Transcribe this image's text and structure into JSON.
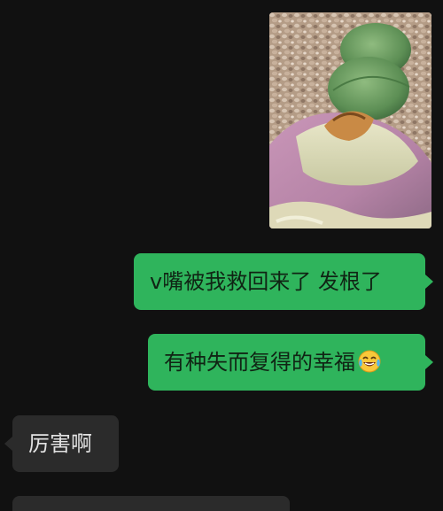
{
  "conversation": {
    "messages": [
      {
        "type": "image",
        "direction": "outgoing",
        "icon": "photo-plant-lithops"
      },
      {
        "type": "text",
        "direction": "outgoing",
        "text": "v嘴被我救回来了 发根了"
      },
      {
        "type": "text",
        "direction": "outgoing",
        "text": "有种失而复得的幸福",
        "emoji": "tears-of-joy-emoji"
      },
      {
        "type": "text",
        "direction": "incoming",
        "text": "厉害啊"
      }
    ]
  },
  "colors": {
    "background": "#111111",
    "outgoing_bubble": "#2fb45c",
    "incoming_bubble": "#2b2b2b"
  }
}
